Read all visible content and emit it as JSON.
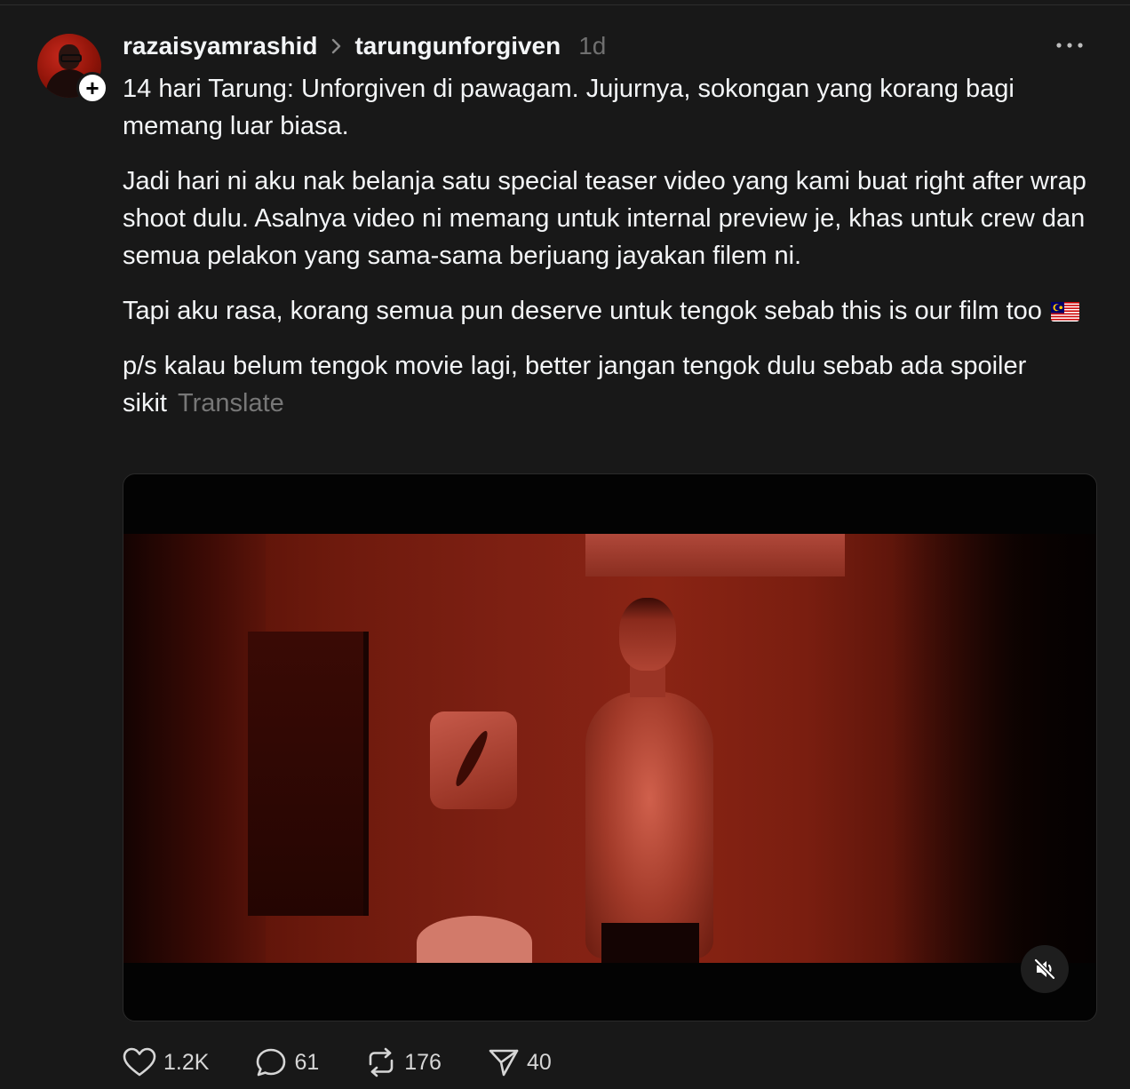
{
  "post": {
    "author": "razaisyamrashid",
    "community": "tarungunforgiven",
    "time": "1d",
    "paragraphs": [
      "14 hari Tarung: Unforgiven di pawagam. Jujurnya, sokongan yang korang bagi memang luar biasa.",
      "Jadi hari ni aku nak belanja satu special teaser video yang kami buat right after wrap shoot dulu. Asalnya video ni memang untuk internal preview je, khas untuk crew dan semua pelakon yang sama-sama berjuang jayakan filem ni.",
      "Tapi aku rasa, korang semua pun deserve untuk tengok sebab this is our film too",
      "p/s kalau belum tengok movie lagi, better jangan tengok dulu sebab ada spoiler sikit"
    ],
    "translate_label": "Translate",
    "flag_icon": "malaysia-flag-emoji"
  },
  "actions": {
    "likes": "1.2K",
    "comments": "61",
    "reposts": "176",
    "shares": "40"
  },
  "icons": {
    "follow": "plus-icon",
    "more": "more-horizontal-icon",
    "mute": "speaker-muted-icon",
    "like": "heart-icon",
    "comment": "comment-icon",
    "repost": "repost-icon",
    "share": "send-icon"
  },
  "colors": {
    "background": "#181818",
    "text": "#f3f5f7",
    "muted": "#777777"
  }
}
